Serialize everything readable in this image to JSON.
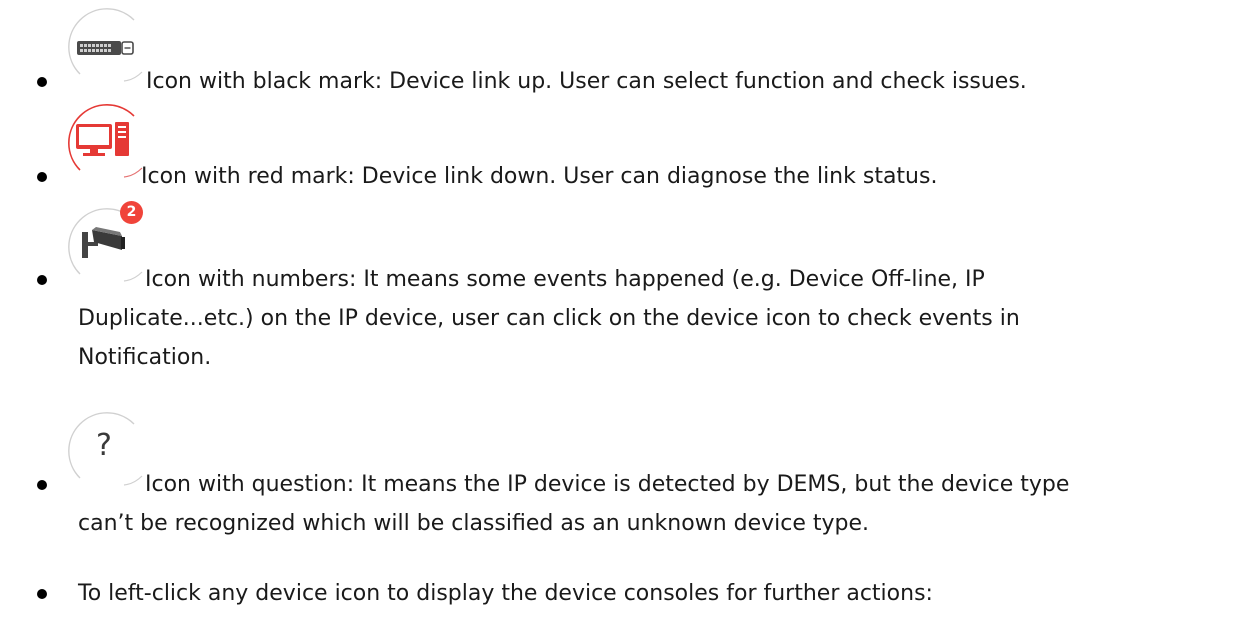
{
  "items": [
    {
      "icon": "switch-device-icon",
      "text": "Icon with black mark: Device link up. User can select function and check issues."
    },
    {
      "icon": "pc-link-down-icon",
      "text": "Icon with red mark: Device link down. User can diagnose the link status."
    },
    {
      "icon": "camera-event-icon",
      "badge": "2",
      "text": "Icon with numbers: It means some events happened (e.g. Device Off-line, IP",
      "continuation": [
        "Duplicate...etc.) on the IP device, user can click on the device icon to check events in",
        "Notification."
      ]
    },
    {
      "icon": "unknown-device-icon",
      "glyph": "?",
      "text": "Icon with question: It means the IP device is detected by DEMS, but the device type",
      "continuation": [
        "can’t be recognized which will be classified as an unknown device type."
      ]
    },
    {
      "text": "To left-click any device icon to display the device consoles for further actions:"
    }
  ],
  "colors": {
    "text": "#1a1a1a",
    "icon_ring": "#d0d0d0",
    "alert_red": "#e53935",
    "badge_red": "#f0443a"
  }
}
